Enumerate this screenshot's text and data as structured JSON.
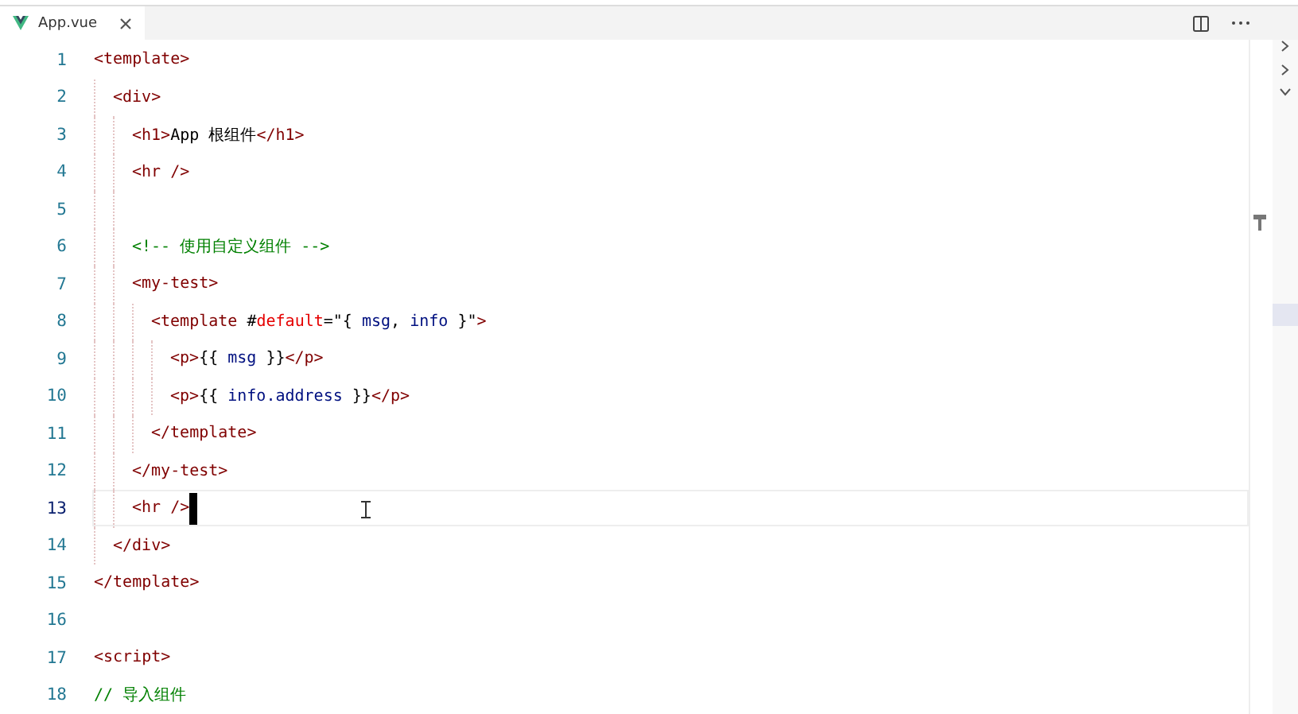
{
  "tabs": [
    {
      "label": "App.vue",
      "selected": true
    }
  ],
  "lines": [
    {
      "number": "1",
      "current": false,
      "tokens": [
        {
          "kind": "tag",
          "text": "<template>"
        }
      ],
      "children": [
        {
          "number": "2",
          "current": false,
          "tokens": [
            {
              "kind": "tag",
              "text": "<div>"
            }
          ],
          "children": [
            {
              "number": "3",
              "current": false,
              "tokens": [
                {
                  "kind": "tag",
                  "text": "<h1>"
                },
                {
                  "kind": "text",
                  "text": "App 根组件"
                },
                {
                  "kind": "tag",
                  "text": "</h1>"
                }
              ]
            },
            {
              "number": "4",
              "current": false,
              "tokens": [
                {
                  "kind": "tag",
                  "text": "<hr />"
                }
              ]
            },
            {
              "number": "5",
              "current": false
            },
            {
              "number": "6",
              "current": false,
              "tokens": [
                {
                  "kind": "comment",
                  "text": "<!-- 使用自定义组件 -->"
                }
              ]
            },
            {
              "number": "7",
              "current": false,
              "tokens": [
                {
                  "kind": "tag",
                  "text": "<my-test>"
                }
              ],
              "children": [
                {
                  "number": "8",
                  "current": false,
                  "tokens": [
                    {
                      "kind": "tag",
                      "text": "<template"
                    },
                    {
                      "kind": "text",
                      "text": " #"
                    },
                    {
                      "kind": "attr",
                      "text": "default"
                    },
                    {
                      "kind": "text",
                      "text": "=\"{ "
                    },
                    {
                      "kind": "var",
                      "text": "msg"
                    },
                    {
                      "kind": "text",
                      "text": ", "
                    },
                    {
                      "kind": "var",
                      "text": "info"
                    },
                    {
                      "kind": "text",
                      "text": " }\""
                    },
                    {
                      "kind": "tag",
                      "text": ">"
                    }
                  ],
                  "children": [
                    {
                      "number": "9",
                      "current": false,
                      "tokens": [
                        {
                          "kind": "tag",
                          "text": "<p>"
                        },
                        {
                          "kind": "text",
                          "text": "{{ "
                        },
                        {
                          "kind": "var",
                          "text": "msg"
                        },
                        {
                          "kind": "text",
                          "text": " }}"
                        },
                        {
                          "kind": "tag",
                          "text": "</p>"
                        }
                      ]
                    },
                    {
                      "number": "10",
                      "current": false,
                      "tokens": [
                        {
                          "kind": "tag",
                          "text": "<p>"
                        },
                        {
                          "kind": "text",
                          "text": "{{ "
                        },
                        {
                          "kind": "var",
                          "text": "info.address"
                        },
                        {
                          "kind": "text",
                          "text": " }}"
                        },
                        {
                          "kind": "tag",
                          "text": "</p>"
                        }
                      ]
                    }
                  ]
                },
                {
                  "number": "11",
                  "current": false,
                  "tokens": [
                    {
                      "kind": "tag",
                      "text": "</template>"
                    }
                  ]
                }
              ]
            },
            {
              "number": "12",
              "current": false,
              "tokens": [
                {
                  "kind": "tag",
                  "text": "</my-test>"
                }
              ]
            },
            {
              "number": "13",
              "current": true,
              "tokens": [
                {
                  "kind": "tag",
                  "text": "<hr />"
                }
              ]
            }
          ]
        },
        {
          "number": "14",
          "current": false,
          "tokens": [
            {
              "kind": "tag",
              "text": "</div>"
            }
          ]
        }
      ]
    },
    {
      "number": "15",
      "current": false,
      "tokens": [
        {
          "kind": "tag",
          "text": "</template>"
        }
      ]
    },
    {
      "number": "16",
      "current": false
    },
    {
      "number": "17",
      "current": false,
      "tokens": [
        {
          "kind": "tag",
          "text": "<script>"
        }
      ]
    },
    {
      "number": "18",
      "current": false,
      "tokens": [
        {
          "kind": "comment",
          "text": "// 导入组件"
        }
      ]
    }
  ]
}
